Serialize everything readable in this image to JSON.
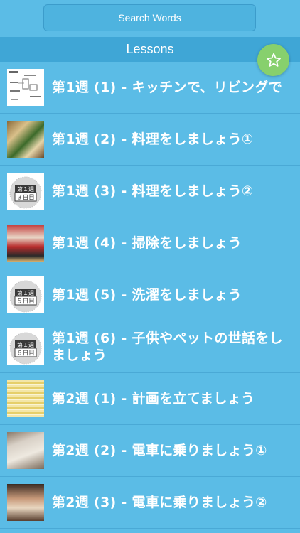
{
  "search": {
    "label": "Search Words"
  },
  "section": {
    "title": "Lessons"
  },
  "lessons": [
    {
      "title": "第1週 (1) - キッチンで、リビングで",
      "thumb": "drawing"
    },
    {
      "title": "第1週 (2) - 料理をしましょう①",
      "thumb": "food"
    },
    {
      "title": "第1週 (3) - 料理をしましょう②",
      "thumb": "calendar",
      "badge_week": "第１週",
      "badge_day": "３日目"
    },
    {
      "title": "第1週 (4) - 掃除をしましょう",
      "thumb": "dolls"
    },
    {
      "title": "第1週 (5) - 洗濯をしましょう",
      "thumb": "calendar",
      "badge_week": "第１週",
      "badge_day": "５日目"
    },
    {
      "title": "第1週 (6) - 子供やペットの世話をしましょう",
      "thumb": "calendar",
      "badge_week": "第１週",
      "badge_day": "６日目"
    },
    {
      "title": "第2週 (1) - 計画を立てましょう",
      "thumb": "sheet"
    },
    {
      "title": "第2週 (2) - 電車に乗りましょう①",
      "thumb": "paper"
    },
    {
      "title": "第2週 (3) - 電車に乗りましょう②",
      "thumb": "people"
    }
  ],
  "colors": {
    "background": "#5bbce6",
    "header": "#3fa6d6",
    "fab": "#87d06d"
  },
  "icons": {
    "fab": "star-icon"
  }
}
